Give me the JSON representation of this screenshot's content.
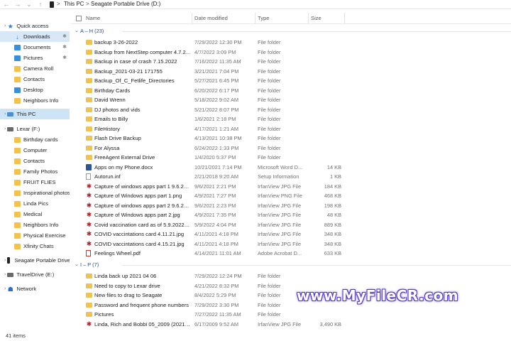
{
  "address": {
    "crumbs": [
      "This PC",
      "Seagate Portable Drive (D:)"
    ],
    "separator": ">"
  },
  "nav_buttons": {
    "back": "←",
    "forward": "→",
    "recent": "⌄",
    "up": "↑"
  },
  "columns": {
    "name": "Name",
    "date": "Date modified",
    "type": "Type",
    "size": "Size"
  },
  "sidebar": {
    "quick_access": "Quick access",
    "quick_items": [
      {
        "label": "Downloads",
        "pinned": true
      },
      {
        "label": "Documents",
        "pinned": true
      },
      {
        "label": "Pictures",
        "pinned": true
      },
      {
        "label": "Camera Roll",
        "pinned": false
      },
      {
        "label": "Contacts",
        "pinned": false
      },
      {
        "label": "Desktop",
        "pinned": false
      },
      {
        "label": "Neighbors Info",
        "pinned": false
      }
    ],
    "this_pc": "This PC",
    "lexar": "Lexar (F:)",
    "lexar_items": [
      "Birthday cards",
      "Computer",
      "Contacts",
      "Family Photos",
      "FRUIT FLIES",
      "Inspirational photos",
      "Linda Pics",
      "Medical",
      "Neighbors Info",
      "Physical Exercise",
      "Xfinity Chats"
    ],
    "seagate": "Seagate Portable Drive",
    "travel": "TravelDrive (E:)",
    "network": "Network",
    "pin_glyph": "✱"
  },
  "groups": [
    {
      "label": "A – H (23)",
      "files": [
        {
          "name": "backup 3-26-2022",
          "date": "7/29/2022 12:30 PM",
          "type": "File folder",
          "size": "",
          "icon": "folder"
        },
        {
          "name": "Backup from NextStep computer 4.7.2...",
          "date": "4/7/2022 3:09 PM",
          "type": "File folder",
          "size": "",
          "icon": "folder"
        },
        {
          "name": "Backup in case of crash 7.15.2022",
          "date": "7/16/2022 11:35 AM",
          "type": "File folder",
          "size": "",
          "icon": "folder"
        },
        {
          "name": "Backup_2021-03-21 171755",
          "date": "3/21/2021 7:04 PM",
          "type": "File folder",
          "size": "",
          "icon": "folder"
        },
        {
          "name": "Backup_Of_C_Fetlife_Directories",
          "date": "5/27/2021 6:45 PM",
          "type": "File folder",
          "size": "",
          "icon": "folder"
        },
        {
          "name": "Birthday Cards",
          "date": "6/20/2022 6:17 PM",
          "type": "File folder",
          "size": "",
          "icon": "folder"
        },
        {
          "name": "David Wrenn",
          "date": "5/18/2022 9:02 AM",
          "type": "File folder",
          "size": "",
          "icon": "folder"
        },
        {
          "name": "DJ photos and vids",
          "date": "5/21/2022 8:07 PM",
          "type": "File folder",
          "size": "",
          "icon": "folder"
        },
        {
          "name": "Emails to Billy",
          "date": "1/6/2021 2:18 PM",
          "type": "File folder",
          "size": "",
          "icon": "folder"
        },
        {
          "name": "FileHistory",
          "date": "4/17/2021 1:21 AM",
          "type": "File folder",
          "size": "",
          "icon": "folder"
        },
        {
          "name": "Flash Drive Backup",
          "date": "4/13/2021 10:38 PM",
          "type": "File folder",
          "size": "",
          "icon": "folder"
        },
        {
          "name": "For Alyssa",
          "date": "6/24/2022 1:33 PM",
          "type": "File folder",
          "size": "",
          "icon": "folder"
        },
        {
          "name": "FreeAgent External Drive",
          "date": "1/4/2020 5:37 PM",
          "type": "File folder",
          "size": "",
          "icon": "folder"
        },
        {
          "name": "Apps on my Phone.docx",
          "date": "10/21/2021 7:14 PM",
          "type": "Microsoft Word D...",
          "size": "14 KB",
          "icon": "doc"
        },
        {
          "name": "Autorun.inf",
          "date": "2/21/2018 9:20 AM",
          "type": "Setup Information",
          "size": "1 KB",
          "icon": "inf"
        },
        {
          "name": "Capture of windows apps part 1 9.6.20...",
          "date": "9/6/2021 2:21 PM",
          "type": "IrfanView JPG File",
          "size": "184 KB",
          "icon": "img"
        },
        {
          "name": "Capture of Windows apps part 1.png",
          "date": "4/9/2021 7:27 PM",
          "type": "IrfanView PNG File",
          "size": "468 KB",
          "icon": "img"
        },
        {
          "name": "Capture of windows apps part 2 9.6.20...",
          "date": "9/6/2021 2:23 PM",
          "type": "IrfanView JPG File",
          "size": "198 KB",
          "icon": "img"
        },
        {
          "name": "Capture of Windows apps part 2.jpg",
          "date": "4/9/2021 7:35 PM",
          "type": "IrfanView JPG File",
          "size": "48 KB",
          "icon": "img"
        },
        {
          "name": "Covid vaccination card as of 5.9.2022.j...",
          "date": "5/9/2022 4:04 PM",
          "type": "IrfanView JPG File",
          "size": "889 KB",
          "icon": "img"
        },
        {
          "name": "COVID vaccintations card 4.11.21.jpg",
          "date": "4/11/2021 4:18 PM",
          "type": "IrfanView JPG File",
          "size": "348 KB",
          "icon": "img"
        },
        {
          "name": "COVID vaccintations card 4.15.21.jpg",
          "date": "4/11/2021 4:18 PM",
          "type": "IrfanView JPG File",
          "size": "348 KB",
          "icon": "img"
        },
        {
          "name": "Feelings Wheel.pdf",
          "date": "4/14/2021 11:01 AM",
          "type": "Adobe Acrobat D...",
          "size": "633 KB",
          "icon": "pdf"
        }
      ]
    },
    {
      "label": "I – P (7)",
      "files": [
        {
          "name": "Linda back up 2021 04 06",
          "date": "7/29/2022 12:24 PM",
          "type": "File folder",
          "size": "",
          "icon": "folder"
        },
        {
          "name": "Need to copy to  Lexar drive",
          "date": "4/21/2022 8:32 PM",
          "type": "File folder",
          "size": "",
          "icon": "folder"
        },
        {
          "name": "New files to drag to Seagate",
          "date": "8/4/2022 5:29 PM",
          "type": "File folder",
          "size": "",
          "icon": "folder"
        },
        {
          "name": "Password and frequent phone numbers",
          "date": "7/29/2022 3:30 PM",
          "type": "File folder",
          "size": "",
          "icon": "folder"
        },
        {
          "name": "Pictures",
          "date": "7/27/2022 11:35 AM",
          "type": "File folder",
          "size": "",
          "icon": "folder"
        },
        {
          "name": "Linda, Rich and Bobbi 05_2009 (2021_...",
          "date": "6/17/2009 9:52 AM",
          "type": "IrfanView JPG File",
          "size": "3,490 KB",
          "icon": "img"
        }
      ]
    }
  ],
  "status": {
    "item_count": "41 items"
  },
  "watermark": {
    "text": "www.MyFileCR.com"
  },
  "colors": {
    "folder": "#f1c24d",
    "selection": "#cde4f7",
    "group_label": "#2c4e80",
    "watermark_glow": "#5b3fd0"
  }
}
